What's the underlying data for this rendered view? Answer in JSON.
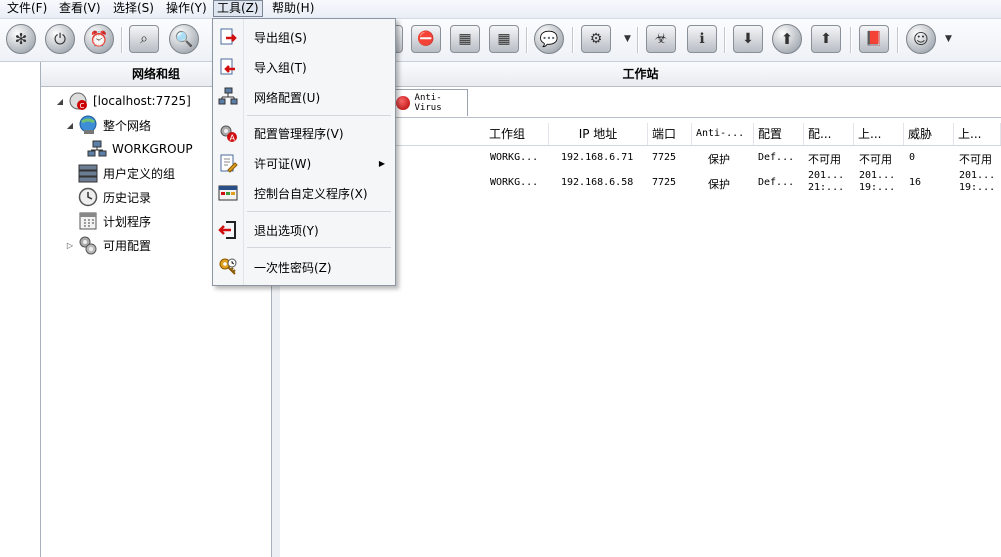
{
  "menubar": {
    "items": [
      {
        "label": "文件(F)"
      },
      {
        "label": "查看(V)"
      },
      {
        "label": "选择(S)"
      },
      {
        "label": "操作(Y)"
      },
      {
        "label": "工具(Z)"
      },
      {
        "label": "帮助(H)"
      }
    ],
    "active_index": 4
  },
  "tools_menu": {
    "items": [
      {
        "label": "导出组(S)",
        "icon": "export-group-icon"
      },
      {
        "label": "导入组(T)",
        "icon": "import-group-icon"
      },
      {
        "label": "网络配置(U)",
        "icon": "network-config-icon"
      },
      {
        "label": "配置管理程序(V)",
        "icon": "config-manager-icon"
      },
      {
        "label": "许可证(W)",
        "icon": "license-icon",
        "has_submenu": true
      },
      {
        "label": "控制台自定义程序(X)",
        "icon": "console-customizer-icon"
      },
      {
        "label": "退出选项(Y)",
        "icon": "exit-options-icon"
      },
      {
        "label": "一次性密码(Z)",
        "icon": "one-time-password-icon"
      }
    ]
  },
  "left_panel": {
    "title": "网络和组",
    "tree": [
      {
        "label": "[localhost:7725]",
        "icon": "server-icon",
        "level": 0,
        "toggle": "expanded"
      },
      {
        "label": "整个网络",
        "icon": "globe-network-icon",
        "level": 1,
        "toggle": "expanded"
      },
      {
        "label": "WORKGROUP",
        "icon": "workgroup-icon",
        "level": 2,
        "toggle": "none"
      },
      {
        "label": "用户定义的组",
        "icon": "user-group-icon",
        "level": 1,
        "toggle": "none"
      },
      {
        "label": "历史记录",
        "icon": "history-clock-icon",
        "level": 1,
        "toggle": "none"
      },
      {
        "label": "计划程序",
        "icon": "scheduler-icon",
        "level": 1,
        "toggle": "none"
      },
      {
        "label": "可用配置",
        "icon": "config-gears-icon",
        "level": 1,
        "toggle": "collapsed"
      }
    ]
  },
  "right_panel": {
    "title": "工作站",
    "tab": {
      "label": "Anti-Virus"
    },
    "columns": [
      "工作组",
      "IP 地址",
      "端口",
      "Anti-...",
      "配置",
      "配...",
      "上...",
      "威胁",
      "上..."
    ],
    "rows": [
      {
        "cells": [
          "WORKG...",
          "192.168.6.71",
          "7725",
          "保护",
          "Def...",
          "不可用",
          "不可用",
          "0",
          "不可用"
        ]
      },
      {
        "cells": [
          "WORKG...",
          "192.168.6.58",
          "7725",
          "保护",
          "Def...",
          "201...\n21:...",
          "201...\n19:...",
          "16",
          "201...\n19:..."
        ]
      }
    ]
  },
  "colors": {
    "menu_bg": "#f5f6f8",
    "accent_red": "#d01010",
    "selection_border": "#7b8796"
  }
}
